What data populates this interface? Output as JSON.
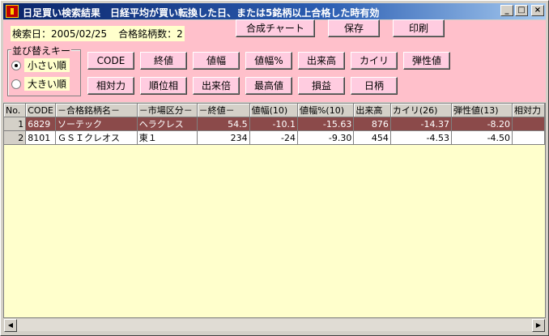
{
  "window": {
    "title": "日足買い検索結果　日経平均が買い転換した日、または5銘柄以上合格した時有効",
    "minimize": "_",
    "maximize": "□",
    "close": "×"
  },
  "info": {
    "search_date": "検索日：2005/02/25",
    "pass_count": "合格銘柄数：2"
  },
  "top_buttons": {
    "chart": "合成チャート",
    "save": "保存",
    "print": "印刷"
  },
  "sort": {
    "title": "並び替えキー",
    "small": "小さい順",
    "large": "大きい順",
    "selected": "small"
  },
  "sort_buttons": {
    "code": "CODE",
    "close_price": "終値",
    "price_range": "値幅",
    "price_range_pct": "値幅%",
    "volume": "出来高",
    "kairi": "カイリ",
    "elasticity": "弾性値",
    "relative_strength": "相対力",
    "rank_phase": "順位相",
    "volume_ratio": "出来倍",
    "high_price": "最高値",
    "profit_loss": "損益",
    "days": "日柄"
  },
  "table": {
    "columns": [
      "No.",
      "CODE",
      "－合格銘柄名－",
      "－市場区分－",
      "－終値－",
      "値幅(10)",
      "値幅%(10)",
      "出来高",
      "カイリ(26)",
      "弾性値(13)",
      "相対力"
    ],
    "rows": [
      {
        "no": "1",
        "code": "6829",
        "name": "ソーテック",
        "market": "ヘラクレス",
        "close": "54.5",
        "range": "-10.1",
        "range_pct": "-15.63",
        "volume": "876",
        "kairi": "-14.37",
        "elasticity": "-8.20",
        "relative": ""
      },
      {
        "no": "2",
        "code": "8101",
        "name": "ＧＳＩクレオス",
        "market": "東１",
        "close": "234",
        "range": "-24",
        "range_pct": "-9.30",
        "volume": "454",
        "kairi": "-4.53",
        "elasticity": "-4.50",
        "relative": ""
      }
    ]
  },
  "colors": {
    "client_bg": "#ffc0cb",
    "grid_bg": "#ffffcc",
    "selected_row": "#8b4a4a",
    "titlebar": "#0a246a"
  }
}
